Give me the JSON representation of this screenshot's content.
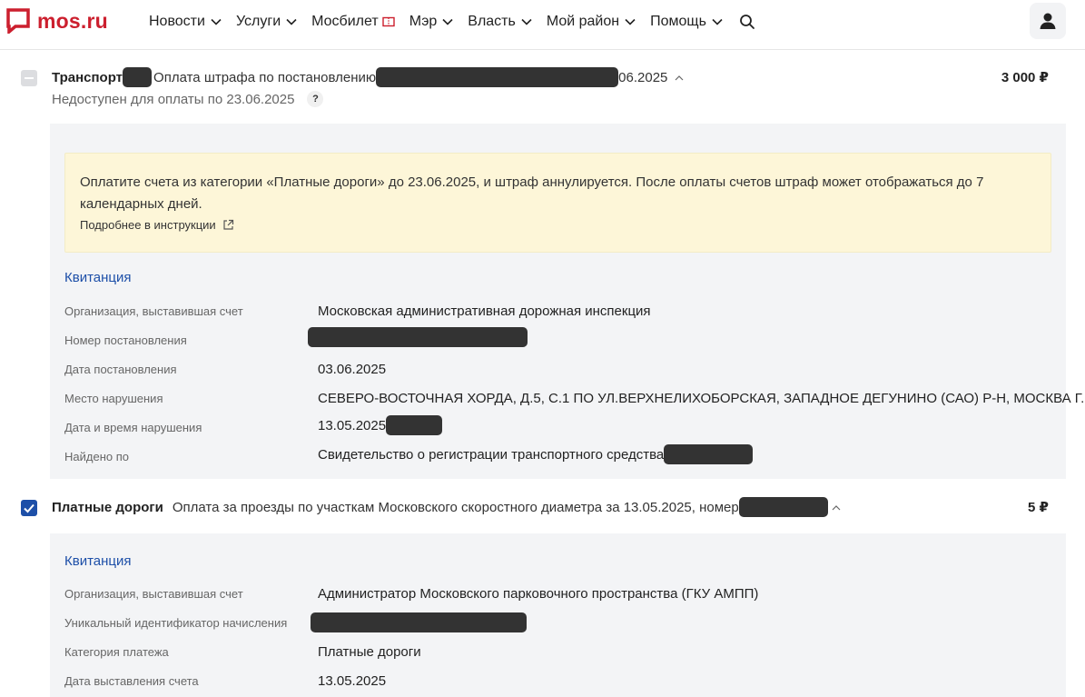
{
  "header": {
    "logo_text": "mos.ru",
    "brand_color": "#cc1f2e",
    "nav": [
      {
        "label": "Новости",
        "icon": "chevron-down-icon"
      },
      {
        "label": "Услуги",
        "icon": "chevron-down-icon"
      },
      {
        "label": "Мосбилет",
        "icon": "ticket-icon"
      },
      {
        "label": "Мэр",
        "icon": "chevron-down-icon"
      },
      {
        "label": "Власть",
        "icon": "chevron-down-icon"
      },
      {
        "label": "Мой район",
        "icon": "chevron-down-icon"
      },
      {
        "label": "Помощь",
        "icon": "chevron-down-icon"
      }
    ],
    "search_icon": "search-icon",
    "profile_icon": "user-icon"
  },
  "transport": {
    "category": "Транспорт",
    "title": "Оплата штрафа по постановлению",
    "title_suffix": "06.2025",
    "amount": "3 000 ₽",
    "status": "Недоступен для оплаты по 23.06.2025",
    "help": "?",
    "checkbox_state": "partial",
    "notice": {
      "text": "Оплатите счета из категории «Платные дороги» до 23.06.2025, и штраф аннулируется. После оплаты счетов штраф может отображаться до 7 календарных дней.",
      "link": "Подробнее в инструкции"
    },
    "receipt_label": "Квитанция",
    "fields": [
      {
        "label": "Организация, выставившая счет",
        "value": "Московская административная дорожная инспекция"
      },
      {
        "label": "Номер постановления",
        "value": ""
      },
      {
        "label": "Дата постановления",
        "value": "03.06.2025"
      },
      {
        "label": "Место нарушения",
        "value": "СЕВЕРО-ВОСТОЧНАЯ ХОРДА, Д.5, С.1 ПО УЛ.ВЕРХНЕЛИХОБОРСКАЯ, ЗАПАДНОЕ ДЕГУНИНО (САО) Р-Н, МОСКВА Г."
      },
      {
        "label": "Дата и время нарушения",
        "value": "13.05.2025"
      },
      {
        "label": "Найдено по",
        "value": "Свидетельство о регистрации транспортного средства"
      }
    ]
  },
  "toll": {
    "category": "Платные дороги",
    "title": "Оплата за проезды по участкам Московского скоростного диаметра за 13.05.2025, номер",
    "amount": "5 ₽",
    "checkbox_state": "checked",
    "receipt_label": "Квитанция",
    "fields": [
      {
        "label": "Организация, выставившая счет",
        "value": "Администратор Московского парковочного пространства (ГКУ АМПП)"
      },
      {
        "label": "Уникальный идентификатор начисления",
        "value": ""
      },
      {
        "label": "Категория платежа",
        "value": "Платные дороги"
      },
      {
        "label": "Дата выставления счета",
        "value": "13.05.2025"
      }
    ]
  },
  "colors": {
    "accent_blue": "#1d4fa8",
    "panel_bg": "#f3f4f6",
    "notice_bg": "#fdf6d8",
    "redaction": "#333333"
  }
}
